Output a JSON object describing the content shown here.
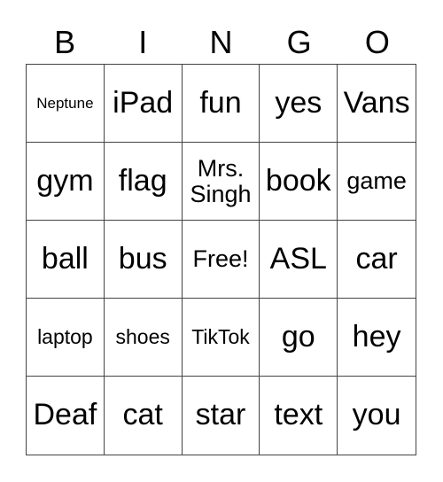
{
  "header": [
    "B",
    "I",
    "N",
    "G",
    "O"
  ],
  "cells": [
    "Neptune",
    "iPad",
    "fun",
    "yes",
    "Vans",
    "gym",
    "flag",
    "Mrs. Singh",
    "book",
    "game",
    "ball",
    "bus",
    "Free!",
    "ASL",
    "car",
    "laptop",
    "shoes",
    "TikTok",
    "go",
    "hey",
    "Deaf",
    "cat",
    "star",
    "text",
    "you"
  ]
}
